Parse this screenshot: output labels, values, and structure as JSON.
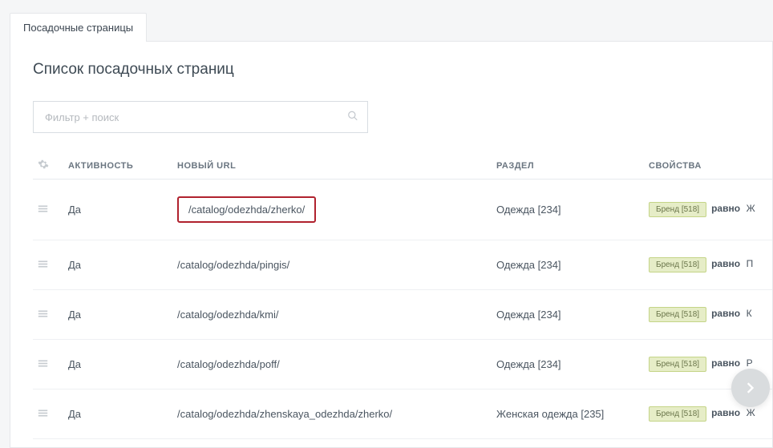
{
  "tabs": {
    "active": "Посадочные страницы"
  },
  "title": "Список посадочных страниц",
  "filter": {
    "placeholder": "Фильтр + поиск"
  },
  "columns": {
    "active": "АКТИВНОСТЬ",
    "url": "НОВЫЙ URL",
    "section": "РАЗДЕЛ",
    "props": "СВОЙСТВА"
  },
  "badge": {
    "brand": "Бренд [518]"
  },
  "op": "равно",
  "rows": [
    {
      "active": "Да",
      "url": "/catalog/odezhda/zherko/",
      "section": "Одежда [234]",
      "extra": "Ж",
      "hl": true
    },
    {
      "active": "Да",
      "url": "/catalog/odezhda/pingis/",
      "section": "Одежда [234]",
      "extra": "П",
      "hl": false
    },
    {
      "active": "Да",
      "url": "/catalog/odezhda/kmi/",
      "section": "Одежда [234]",
      "extra": "К",
      "hl": false
    },
    {
      "active": "Да",
      "url": "/catalog/odezhda/poff/",
      "section": "Одежда [234]",
      "extra": "Р",
      "hl": false
    },
    {
      "active": "Да",
      "url": "/catalog/odezhda/zhenskaya_odezhda/zherko/",
      "section": "Женская одежда [235]",
      "extra": "Ж",
      "hl": false
    }
  ]
}
